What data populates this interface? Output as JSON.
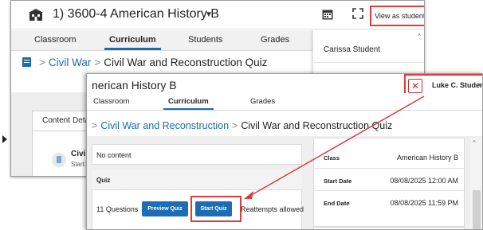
{
  "back_window": {
    "title": "1) 3600-4 American History B",
    "view_as_student": "View as student",
    "tabs": [
      "Classroom",
      "Curriculum",
      "Students",
      "Grades"
    ],
    "breadcrumb": {
      "parent": "Civil War",
      "current": "Civil War and Reconstruction Quiz"
    },
    "dropdown_item": "Carissa Student",
    "content_tabs": [
      "Content",
      "Deta"
    ],
    "item_title": "Civil",
    "item_start": "Start:"
  },
  "front_window": {
    "title": "nerican History B",
    "student_name": "Luke C. Student",
    "tabs": [
      "Classroom",
      "Curriculum",
      "Grades"
    ],
    "breadcrumb": {
      "parent": "Civil War and Reconstruction",
      "current": "Civil War and Reconstruction Quiz"
    },
    "no_content": "No content",
    "quiz_label": "Quiz",
    "question_count": "11 Questions",
    "preview_button": "Preview Quiz",
    "start_button": "Start Quiz",
    "reattempts": "Reattempts allowed",
    "details": [
      {
        "label": "Class",
        "value": "American History B"
      },
      {
        "label": "Start Date",
        "value": "08/08/2025 12:00 AM"
      },
      {
        "label": "End Date",
        "value": "08/08/2025 11:59 PM"
      }
    ]
  },
  "colors": {
    "accent": "#1a6cb0",
    "highlight": "#e23a3a"
  }
}
